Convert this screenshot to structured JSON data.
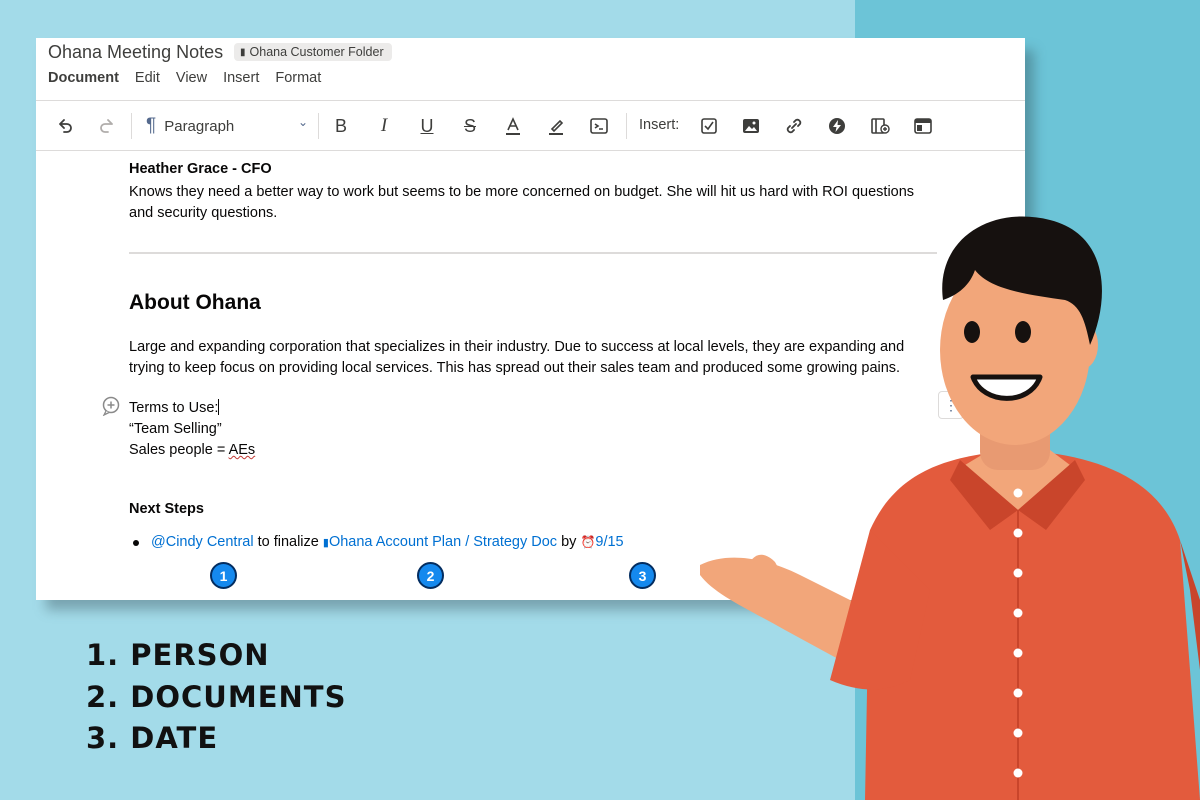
{
  "document": {
    "title": "Ohana Meeting Notes",
    "folder": "Ohana Customer Folder",
    "menu": [
      "Document",
      "Edit",
      "View",
      "Insert",
      "Format"
    ]
  },
  "toolbar": {
    "paragraph_style": "Paragraph",
    "insert_label": "Insert:",
    "icons": [
      "undo-icon",
      "redo-icon",
      "paragraph-icon",
      "bold-icon",
      "italic-icon",
      "underline-icon",
      "strikethrough-icon",
      "text-color-icon",
      "highlight-icon",
      "code-block-icon",
      "checkbox-icon",
      "image-icon",
      "link-icon",
      "lightning-icon",
      "table-insert-icon",
      "embed-icon"
    ]
  },
  "body": {
    "person_name": "Heather Grace - CFO",
    "person_desc": "Knows they need a better way to work but seems to be more concerned on budget. She will hit us hard with ROI questions and security questions.",
    "about_title": "About Ohana",
    "about_desc": "Large and expanding corporation that specializes in their industry. Due to success at local levels, they are expanding and trying to keep focus on providing local services. This has spread out their sales team and produced some growing pains.",
    "terms_label": "Terms to Use:",
    "terms_item1": "“Team Selling”",
    "terms_item2_prefix": "Sales people = ",
    "terms_item2_term": "AEs",
    "next_steps_title": "Next Steps",
    "next_step": {
      "mention": "@Cindy Central",
      "middle": " to finalize ",
      "doc_link": "Ohana Account Plan / Strategy Doc",
      "by": " by ",
      "date": "9/15"
    }
  },
  "markers": [
    "1",
    "2",
    "3"
  ],
  "callouts": [
    "1. PERSON",
    "2. DOCUMENTS",
    "3. DATE"
  ],
  "colors": {
    "background": "#a3dbe9",
    "background_right": "#6cc4d7",
    "link": "#0070d2",
    "marker": "#1589ee",
    "shirt": "#e35b3d"
  }
}
